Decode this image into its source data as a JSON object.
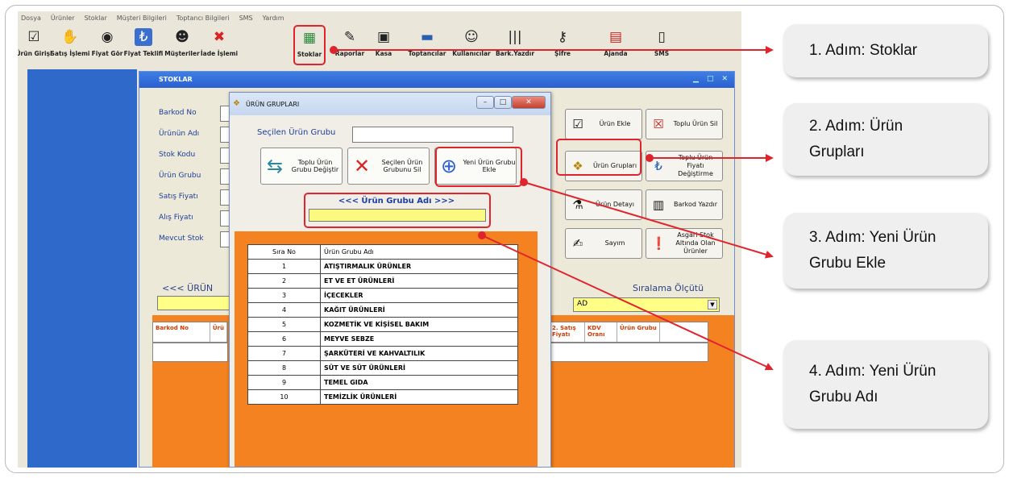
{
  "menu": [
    "Dosya",
    "Ürünler",
    "Stoklar",
    "Müşteri Bilgileri",
    "Toptancı Bilgileri",
    "SMS",
    "Yardım"
  ],
  "toolbar": [
    {
      "label": "Ürün Girişi",
      "icon": "checkbox-icon"
    },
    {
      "label": "Satış İşlemi",
      "icon": "handshake-icon"
    },
    {
      "label": "Fiyat Gör",
      "icon": "eye-icon"
    },
    {
      "label": "Fiyat Teklifi",
      "icon": "price-offer-icon"
    },
    {
      "label": "Müşteriler",
      "icon": "customers-icon"
    },
    {
      "label": "İade İşlemi",
      "icon": "return-icon"
    },
    {
      "label": "Stoklar",
      "icon": "stock-icon"
    },
    {
      "label": "Raporlar",
      "icon": "report-icon"
    },
    {
      "label": "Kasa",
      "icon": "cash-register-icon"
    },
    {
      "label": "Toptancılar",
      "icon": "truck-icon"
    },
    {
      "label": "Kullanıcılar",
      "icon": "users-icon"
    },
    {
      "label": "Bark.Yazdır",
      "icon": "barcode-icon"
    },
    {
      "label": "Şifre",
      "icon": "key-icon"
    },
    {
      "label": "Ajanda",
      "icon": "calendar-icon"
    },
    {
      "label": "SMS",
      "icon": "phone-icon"
    }
  ],
  "stoklar": {
    "title": "STOKLAR",
    "fields": [
      "Barkod No",
      "Ürünün Adı",
      "Stok Kodu",
      "Ürün Grubu",
      "Satış Fiyatı",
      "Alış Fiyatı",
      "Mevcut Stok"
    ],
    "buttons": {
      "urun_ekle": "Ürün Ekle",
      "toplu_urun_sil": "Toplu Ürün Sil",
      "urun_gruplari": "Ürün Grupları",
      "toplu_fiyat": "Toplu Ürün Fiyatı Değiştirme",
      "urun_detayi": "Ürün Detayı",
      "barkod_yazdir": "Barkod Yazdır",
      "sayim": "Sayım",
      "asgari": "Asgari Stok Altında Olan Ürünler"
    },
    "search_label": "<<< ÜRÜN",
    "sirala_label": "Sıralama Ölçütü",
    "sirala_value": "AD",
    "table_headers": [
      "Barkod No",
      "Ürü",
      "2. Satış Fiyatı",
      "KDV Oranı",
      "Ürün Grubu"
    ]
  },
  "dialog": {
    "title": "ÜRÜN GRUPLARI",
    "secilen_label": "Seçilen Ürün Grubu",
    "btn_toplu": "Toplu Ürün Grubu Değiştir",
    "btn_sil": "Seçilen Ürün Grubunu Sil",
    "btn_yeni": "Yeni Ürün Grubu Ekle",
    "grup_adi_label": "<<< Ürün Grubu Adı >>>",
    "table_headers": [
      "Sıra No",
      "Ürün Grubu Adı"
    ],
    "rows": [
      {
        "no": "1",
        "name": "ATIŞTIRMALIK ÜRÜNLER"
      },
      {
        "no": "2",
        "name": "ET VE ET ÜRÜNLERİ"
      },
      {
        "no": "3",
        "name": "İÇECEKLER"
      },
      {
        "no": "4",
        "name": "KAĞIT ÜRÜNLERİ"
      },
      {
        "no": "5",
        "name": "KOZMETİK VE KİŞİSEL BAKIM"
      },
      {
        "no": "6",
        "name": "MEYVE SEBZE"
      },
      {
        "no": "7",
        "name": "ŞARKÜTERİ VE KAHVALTILIK"
      },
      {
        "no": "8",
        "name": "SÜT VE SÜT ÜRÜNLERİ"
      },
      {
        "no": "9",
        "name": "TEMEL GIDA"
      },
      {
        "no": "10",
        "name": "TEMİZLİK ÜRÜNLERİ"
      }
    ]
  },
  "callouts": {
    "step1": "1. Adım: Stoklar",
    "step2": "2. Adım: Ürün Grupları",
    "step3": "3. Adım: Yeni Ürün Grubu Ekle",
    "step4": "4. Adım: Yeni Ürün Grubu Adı"
  },
  "colors": {
    "highlight": "#e0242e",
    "orange": "#f58220",
    "blue_panel": "#2f69c9",
    "yellow_input": "#ffff88"
  }
}
